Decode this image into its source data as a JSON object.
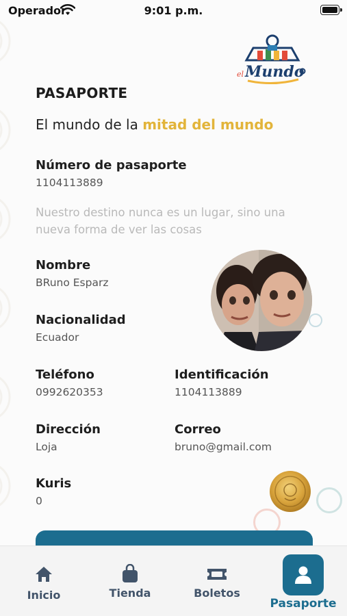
{
  "status_bar": {
    "carrier": "Operador",
    "time": "9:01 p.m."
  },
  "logo": {
    "text": "elMundo"
  },
  "header": {
    "title": "PASAPORTE",
    "subtitle_prefix": "El mundo de la ",
    "subtitle_highlight": "mitad del mundo"
  },
  "passport": {
    "number_label": "Número de pasaporte",
    "number_value": "1104113889",
    "quote": "Nuestro destino nunca es un lugar, sino una nueva forma de ver las cosas",
    "name_label": "Nombre",
    "name_value": "BRuno Esparz",
    "nationality_label": "Nacionalidad",
    "nationality_value": "Ecuador",
    "phone_label": "Teléfono",
    "phone_value": "0992620353",
    "id_label": "Identificación",
    "id_value": "1104113889",
    "address_label": "Dirección",
    "address_value": "Loja",
    "email_label": "Correo",
    "email_value": "bruno@gmail.com",
    "kuris_label": "Kuris",
    "kuris_value": "0"
  },
  "tabs": [
    {
      "label": "Inicio",
      "icon": "home-icon"
    },
    {
      "label": "Tienda",
      "icon": "bag-icon"
    },
    {
      "label": "Boletos",
      "icon": "ticket-icon"
    },
    {
      "label": "Pasaporte",
      "icon": "user-icon",
      "active": true
    }
  ],
  "colors": {
    "accent": "#1c6d8f",
    "highlight": "#e2b43a",
    "tab_inactive": "#42546a"
  }
}
